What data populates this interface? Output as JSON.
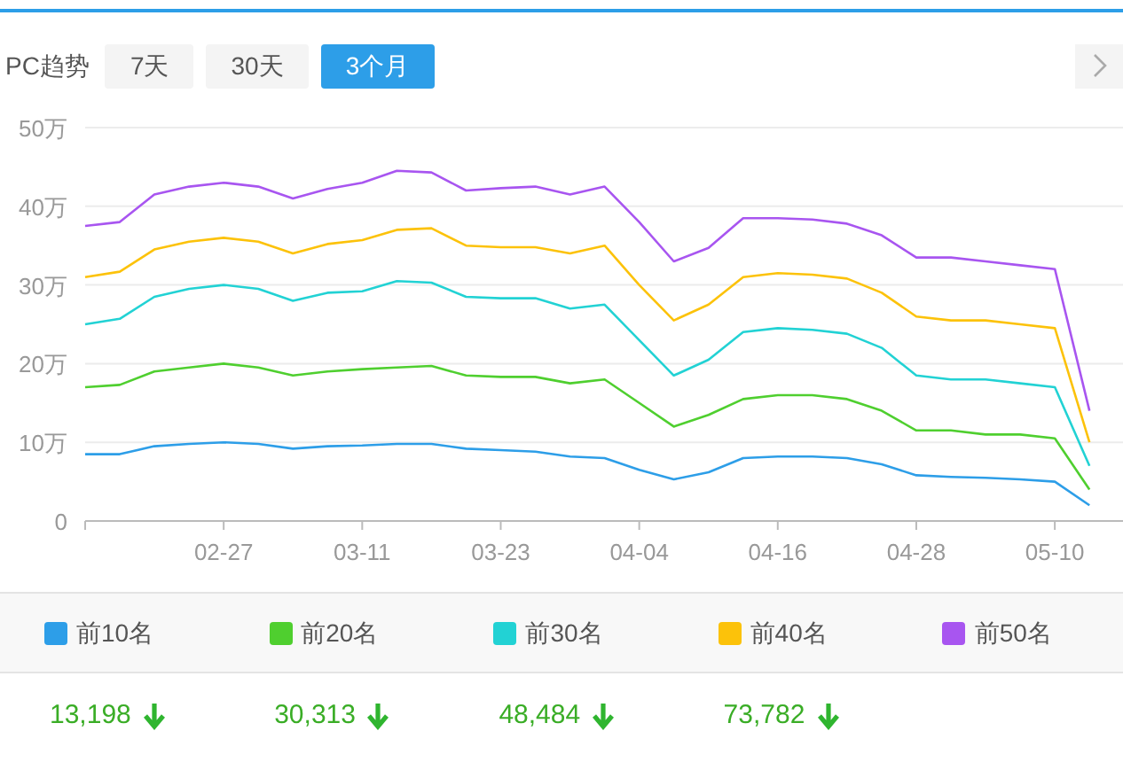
{
  "header": {
    "label": "PC趋势"
  },
  "tabs": [
    {
      "label": "7天",
      "selected": false
    },
    {
      "label": "30天",
      "selected": false
    },
    {
      "label": "3个月",
      "selected": true
    }
  ],
  "chart_data": {
    "type": "line",
    "categories": [
      null,
      null,
      null,
      null,
      "02-27",
      null,
      null,
      null,
      "03-11",
      null,
      null,
      null,
      "03-23",
      null,
      null,
      null,
      "04-04",
      null,
      null,
      null,
      "04-16",
      null,
      null,
      null,
      "04-28",
      null,
      null,
      null,
      "05-10",
      null
    ],
    "ylim": [
      0,
      50
    ],
    "grid": true,
    "yticks": [
      0,
      {
        "value": 10,
        "label": "10万"
      },
      {
        "value": 20,
        "label": "20万"
      },
      {
        "value": 30,
        "label": "30万"
      },
      {
        "value": 40,
        "label": "40万"
      },
      {
        "value": 50,
        "label": "50万"
      }
    ],
    "series": [
      {
        "name": "前10名",
        "color": "#2d9ee8",
        "values": [
          8.5,
          8.5,
          9.5,
          9.8,
          10,
          9.8,
          9.2,
          9.5,
          9.6,
          9.8,
          9.8,
          9.2,
          9,
          8.8,
          8.2,
          8,
          6.5,
          5.3,
          6.2,
          8,
          8.2,
          8.2,
          8,
          7.2,
          5.8,
          5.6,
          5.5,
          5.3,
          5,
          2
        ]
      },
      {
        "name": "前20名",
        "color": "#4fcf2f",
        "values": [
          17,
          17.3,
          19,
          19.5,
          20,
          19.5,
          18.5,
          19,
          19.3,
          19.5,
          19.7,
          18.5,
          18.3,
          18.3,
          17.5,
          18,
          15,
          12,
          13.5,
          15.5,
          16,
          16,
          15.5,
          14,
          11.5,
          11.5,
          11,
          11,
          10.5,
          4
        ]
      },
      {
        "name": "前30名",
        "color": "#22d2d4",
        "values": [
          25,
          25.7,
          28.5,
          29.5,
          30,
          29.5,
          28,
          29,
          29.2,
          30.5,
          30.3,
          28.5,
          28.3,
          28.3,
          27,
          27.5,
          23,
          18.5,
          20.5,
          24,
          24.5,
          24.3,
          23.8,
          22,
          18.5,
          18,
          18,
          17.5,
          17,
          7
        ]
      },
      {
        "name": "前40名",
        "color": "#fcc20a",
        "values": [
          31,
          31.7,
          34.5,
          35.5,
          36,
          35.5,
          34,
          35.2,
          35.7,
          37,
          37.2,
          35,
          34.8,
          34.8,
          34,
          35,
          30,
          25.5,
          27.5,
          31,
          31.5,
          31.3,
          30.8,
          29,
          26,
          25.5,
          25.5,
          25,
          24.5,
          10
        ]
      },
      {
        "name": "前50名",
        "color": "#a855f0",
        "values": [
          37.5,
          38,
          41.5,
          42.5,
          43,
          42.5,
          41,
          42.2,
          43,
          44.5,
          44.3,
          42,
          42.3,
          42.5,
          41.5,
          42.5,
          38,
          33,
          34.7,
          38.5,
          38.5,
          38.3,
          37.8,
          36.3,
          33.5,
          33.5,
          33,
          32.5,
          32,
          14
        ]
      }
    ]
  },
  "totals": [
    {
      "value": "13,198",
      "kind": "down"
    },
    {
      "value": "30,313",
      "kind": "down"
    },
    {
      "value": "48,484",
      "kind": "down"
    },
    {
      "value": "73,782",
      "kind": "down"
    }
  ]
}
